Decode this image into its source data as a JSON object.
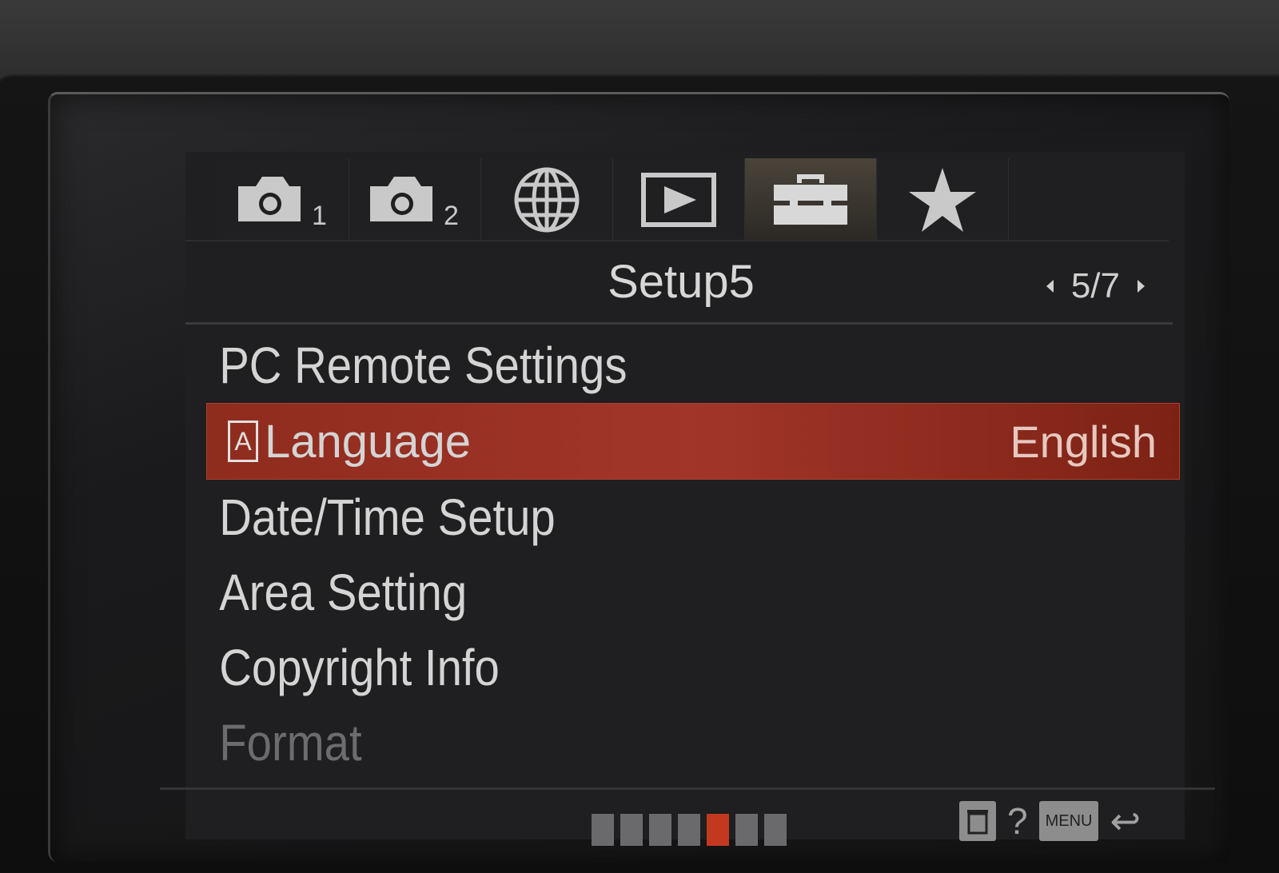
{
  "tabs": [
    {
      "name": "camera-1-icon",
      "number": "1",
      "active": false
    },
    {
      "name": "camera-2-icon",
      "number": "2",
      "active": false
    },
    {
      "name": "network-globe-icon",
      "number": "",
      "active": false
    },
    {
      "name": "playback-icon",
      "number": "",
      "active": false
    },
    {
      "name": "setup-toolbox-icon",
      "number": "",
      "active": true
    },
    {
      "name": "my-menu-star-icon",
      "number": "",
      "active": false
    }
  ],
  "header": {
    "title": "Setup5",
    "page_indicator": "5/7"
  },
  "menu_items": [
    {
      "label": "PC Remote Settings",
      "value": "",
      "selected": false,
      "dim": false
    },
    {
      "label": "Language",
      "value": "English",
      "selected": true,
      "dim": false
    },
    {
      "label": "Date/Time Setup",
      "value": "",
      "selected": false,
      "dim": false
    },
    {
      "label": "Area Setting",
      "value": "",
      "selected": false,
      "dim": false
    },
    {
      "label": "Copyright Info",
      "value": "",
      "selected": false,
      "dim": false
    },
    {
      "label": "Format",
      "value": "",
      "selected": false,
      "dim": true
    }
  ],
  "language_icon_letter": "A",
  "footer": {
    "page_dots_total": 7,
    "page_dots_active_index": 4,
    "help_symbol": "?",
    "menu_key_label": "MENU"
  },
  "colors": {
    "selection": "#a2352a",
    "active_dot": "#c2391f",
    "text": "#d4d4d4"
  }
}
